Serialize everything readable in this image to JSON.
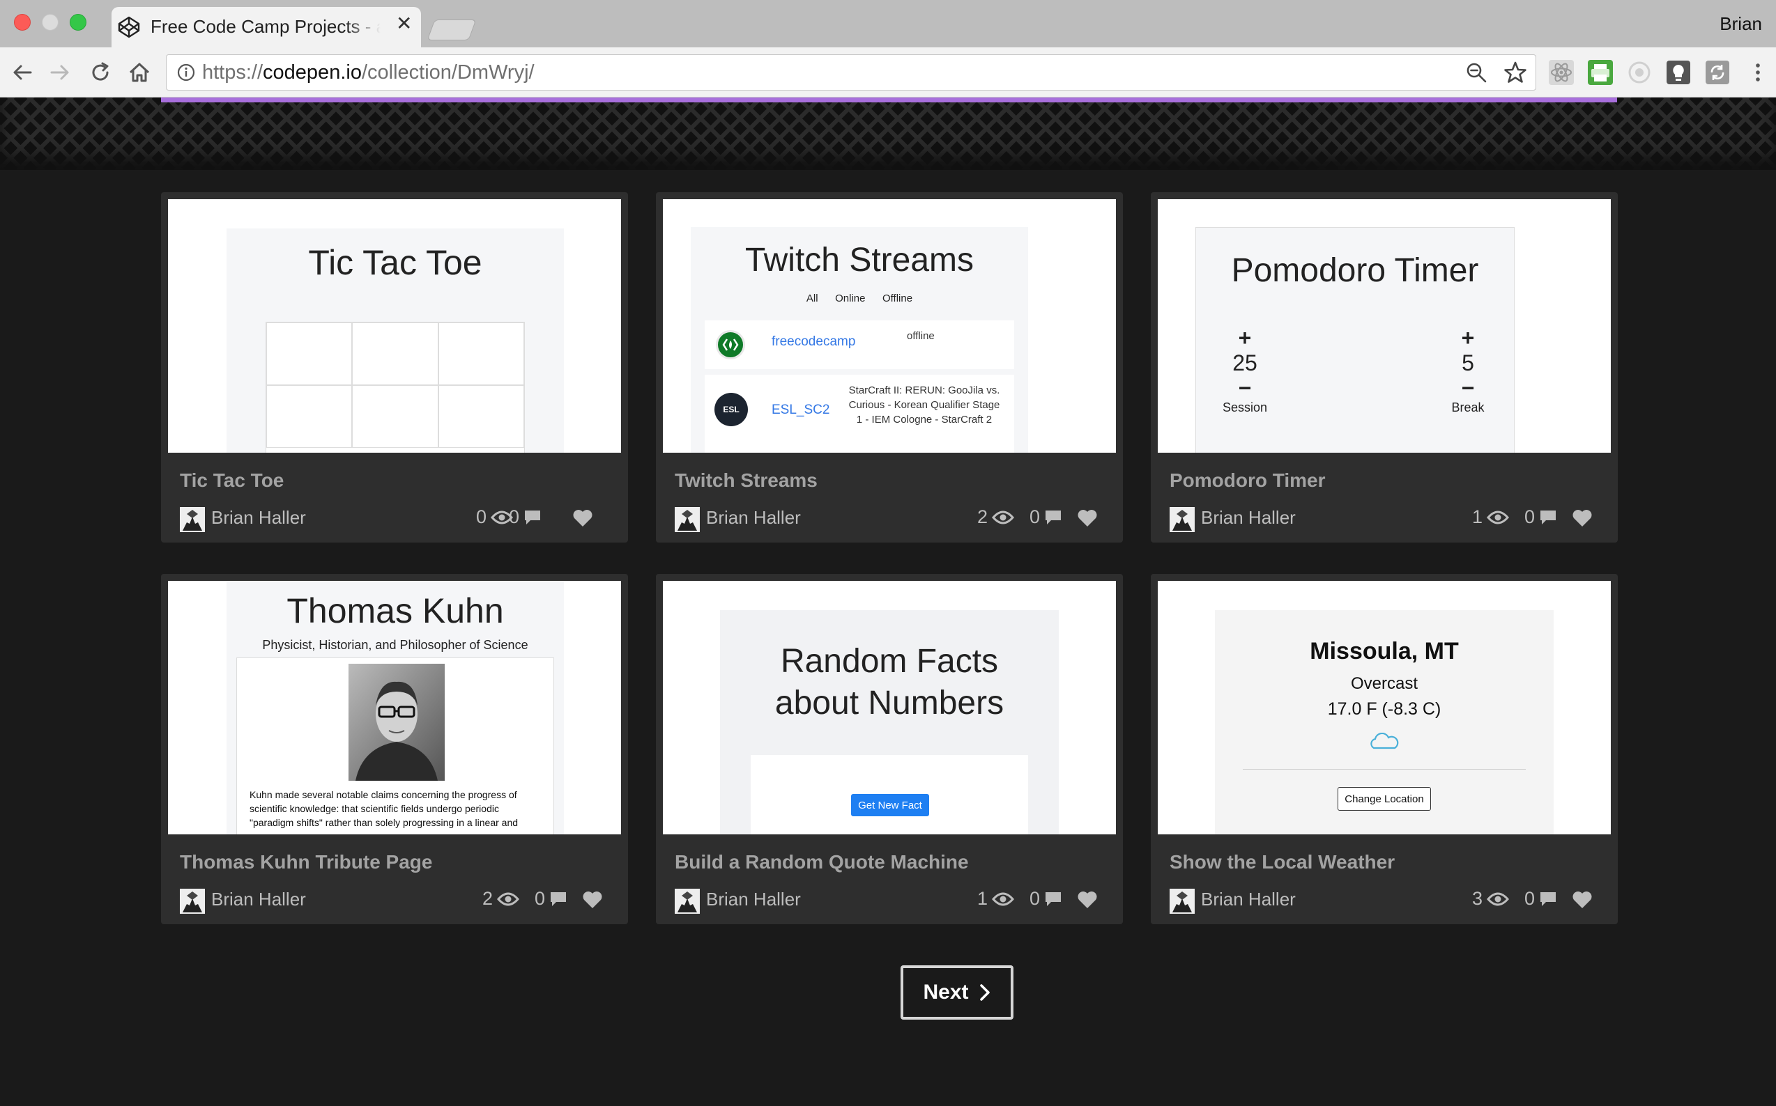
{
  "browser": {
    "tab_title": "Free Code Camp Projects - a C",
    "profile_name": "Brian",
    "url_scheme": "https://",
    "url_host": "codepen.io",
    "url_path": "/collection/DmWryj/"
  },
  "colors": {
    "accent_purple": "#a86fdc",
    "page_bg": "#1a1a1a",
    "card_bg": "#2e2e2e",
    "link_blue": "#3478e5"
  },
  "cards": [
    {
      "title": "Tic Tac Toe",
      "author": "Brian Haller",
      "views": "0",
      "comments": "0",
      "preview": {
        "heading": "Tic Tac Toe"
      }
    },
    {
      "title": "Twitch Streams",
      "author": "Brian Haller",
      "views": "2",
      "comments": "0",
      "preview": {
        "heading": "Twitch Streams",
        "filters": [
          "All",
          "Online",
          "Offline"
        ],
        "rows": [
          {
            "name": "freecodecamp",
            "status": "offline"
          },
          {
            "name": "ESL_SC2",
            "status": "StarCraft II: RERUN: GooJila vs. Curious - Korean Qualifier Stage 1 - IEM Cologne - StarCraft 2",
            "logo_text": "ESL"
          }
        ]
      }
    },
    {
      "title": "Pomodoro Timer",
      "author": "Brian Haller",
      "views": "1",
      "comments": "0",
      "preview": {
        "heading": "Pomodoro Timer",
        "session_value": "25",
        "session_label": "Session",
        "break_value": "5",
        "break_label": "Break",
        "plus": "+",
        "minus": "−"
      }
    },
    {
      "title": "Thomas Kuhn Tribute Page",
      "author": "Brian Haller",
      "views": "2",
      "comments": "0",
      "preview": {
        "heading": "Thomas Kuhn",
        "subheading": "Physicist, Historian, and Philosopher of Science",
        "body": "Kuhn made several notable claims concerning the progress of scientific knowledge: that scientific fields undergo periodic \"paradigm shifts\" rather than solely progressing in a linear and"
      }
    },
    {
      "title": "Build a Random Quote Machine",
      "author": "Brian Haller",
      "views": "1",
      "comments": "0",
      "preview": {
        "heading_line1": "Random Facts",
        "heading_line2": "about Numbers",
        "button": "Get New Fact"
      }
    },
    {
      "title": "Show the Local Weather",
      "author": "Brian Haller",
      "views": "3",
      "comments": "0",
      "preview": {
        "city": "Missoula, MT",
        "condition": "Overcast",
        "temp": "17.0 F (-8.3 C)",
        "button": "Change Location"
      }
    }
  ],
  "pagination": {
    "next_label": "Next"
  }
}
